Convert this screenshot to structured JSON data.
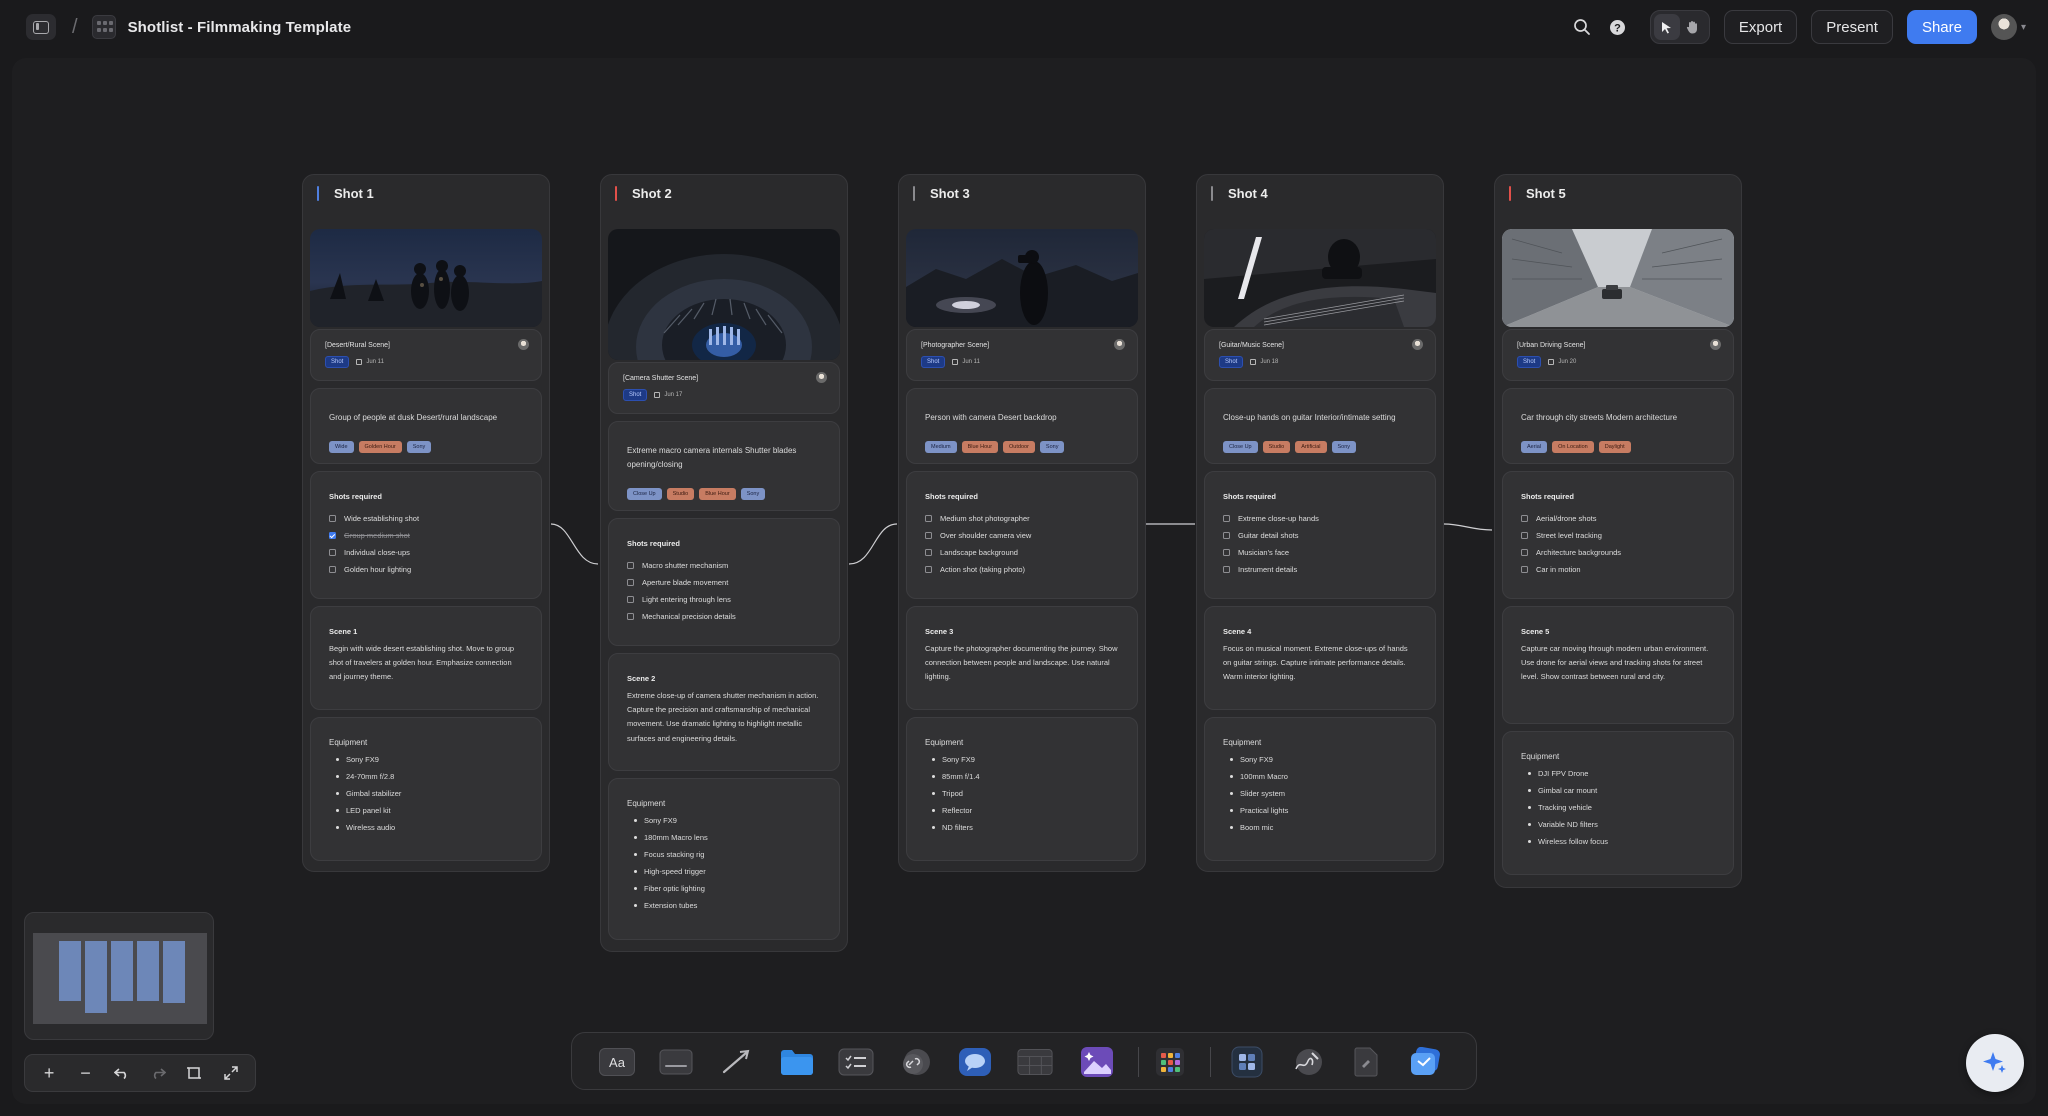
{
  "header": {
    "doc_title": "Shotlist - Filmmaking Template",
    "breadcrumb_separator": "/",
    "export_label": "Export",
    "present_label": "Present",
    "share_label": "Share"
  },
  "colors": {
    "accent": "#3f7bf0",
    "frame_bar_1": "#4f7fe0",
    "frame_bar_2": "#e2504a",
    "frame_bar_3": "#8a8a8e",
    "frame_bar_4": "#8a8a8e",
    "frame_bar_5": "#e2504a"
  },
  "shots": [
    {
      "title": "Shot 1",
      "scene_label": "[Desert/Rural Scene]",
      "badge": "Shot",
      "date": "Jun 11",
      "description": "Group of people at dusk Desert/rural landscape",
      "tags": [
        "Wide",
        "Golden Hour",
        "Sony"
      ],
      "shots_required_title": "Shots required",
      "shots_required": [
        "Wide establishing shot",
        "Group medium shot",
        "Individual close-ups",
        "Golden hour lighting"
      ],
      "scene_title": "Scene 1",
      "scene_text": "Begin with wide desert establishing shot. Move to group shot of travelers at golden hour. Emphasize connection and journey theme.",
      "equipment_title": "Equipment",
      "equipment": [
        "Sony FX9",
        "24-70mm f/2.8",
        "Gimbal stabilizer",
        "LED panel kit",
        "Wireless audio"
      ]
    },
    {
      "title": "Shot 2",
      "scene_label": "[Camera Shutter Scene]",
      "badge": "Shot",
      "date": "Jun 17",
      "description": "Extreme macro camera internals Shutter blades opening/closing",
      "tags": [
        "Close Up",
        "Studio",
        "Blue Hour",
        "Sony"
      ],
      "shots_required_title": "Shots required",
      "shots_required": [
        "Macro shutter mechanism",
        "Aperture blade movement",
        "Light entering through lens",
        "Mechanical precision details"
      ],
      "scene_title": "Scene 2",
      "scene_text": "Extreme close-up of camera shutter mechanism in action. Capture the precision and craftsmanship of mechanical movement. Use dramatic lighting to highlight metallic surfaces and engineering details.",
      "equipment_title": "Equipment",
      "equipment": [
        "Sony FX9",
        "180mm Macro lens",
        "Focus stacking rig",
        "High-speed trigger",
        "Fiber optic lighting",
        "Extension tubes"
      ]
    },
    {
      "title": "Shot 3",
      "scene_label": "[Photographer Scene]",
      "badge": "Shot",
      "date": "Jun 11",
      "description": "Person with camera Desert backdrop",
      "tags": [
        "Medium",
        "Blue Hour",
        "Outdoor",
        "Sony"
      ],
      "shots_required_title": "Shots required",
      "shots_required": [
        "Medium shot photographer",
        "Over shoulder camera view",
        "Landscape background",
        "Action shot (taking photo)"
      ],
      "scene_title": "Scene 3",
      "scene_text": "Capture the photographer documenting the journey. Show connection between people and landscape. Use natural lighting.",
      "equipment_title": "Equipment",
      "equipment": [
        "Sony FX9",
        "85mm f/1.4",
        "Tripod",
        "Reflector",
        "ND filters"
      ]
    },
    {
      "title": "Shot 4",
      "scene_label": "[Guitar/Music Scene]",
      "badge": "Shot",
      "date": "Jun 18",
      "description": "Close-up hands on guitar Interior/intimate setting",
      "tags": [
        "Close Up",
        "Studio",
        "Artificial",
        "Sony"
      ],
      "shots_required_title": "Shots required",
      "shots_required": [
        "Extreme close-up hands",
        "Guitar detail shots",
        "Musician's face",
        "Instrument details"
      ],
      "scene_title": "Scene 4",
      "scene_text": "Focus on musical moment. Extreme close-ups of hands on guitar strings. Capture intimate performance details. Warm interior lighting.",
      "equipment_title": "Equipment",
      "equipment": [
        "Sony FX9",
        "100mm Macro",
        "Slider system",
        "Practical lights",
        "Boom mic"
      ]
    },
    {
      "title": "Shot 5",
      "scene_label": "[Urban Driving Scene]",
      "badge": "Shot",
      "date": "Jun 20",
      "description": "Car through city streets Modern architecture",
      "tags": [
        "Aerial",
        "On Location",
        "Daylight"
      ],
      "shots_required_title": "Shots required",
      "shots_required": [
        "Aerial/drone shots",
        "Street level tracking",
        "Architecture backgrounds",
        "Car in motion"
      ],
      "scene_title": "Scene 5",
      "scene_text": "Capture car moving through modern urban environment. Use drone for aerial views and tracking shots for street level. Show contrast between rural and city.",
      "equipment_title": "Equipment",
      "equipment": [
        "DJI FPV Drone",
        "Gimbal car mount",
        "Tracking vehicle",
        "Variable ND filters",
        "Wireless follow focus"
      ]
    }
  ],
  "zoom_controls": [
    "zoom-in",
    "zoom-out",
    "undo",
    "redo",
    "fit-frame",
    "fullscreen"
  ],
  "dock_text_tool_label": "Aa"
}
